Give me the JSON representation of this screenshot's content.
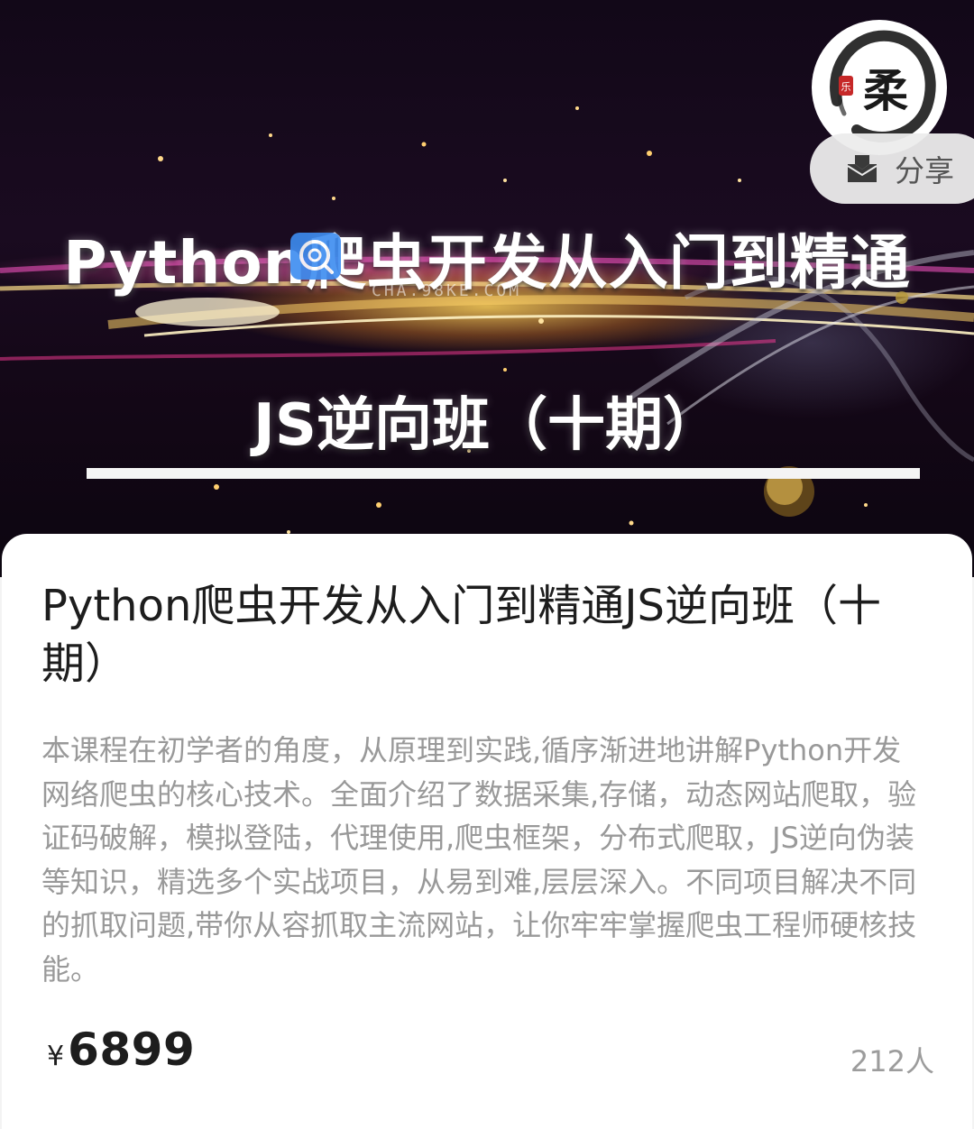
{
  "banner": {
    "title_line1": "Python爬虫开发从入门到精通",
    "title_line2": "JS逆向班（十期）",
    "watermark_text": "CHA.98KE.COM",
    "seal_char": "柔",
    "seal_stamp": "乐"
  },
  "share": {
    "label": "分享",
    "icon": "share-envelope-icon"
  },
  "course": {
    "title": "Python爬虫开发从入门到精通JS逆向班（十期）",
    "description": "本课程在初学者的角度，从原理到实践,循序渐进地讲解Python开发网络爬虫的核心技术。全面介绍了数据采集,存储，动态网站爬取，验证码破解，模拟登陆，代理使用,爬虫框架，分布式爬取，JS逆向伪装等知识，精选多个实战项目，从易到难,层层深入。不同项目解决不同的抓取问题,带你从容抓取主流网站，让你牢牢掌握爬虫工程师硬核技能。",
    "price_symbol": "¥",
    "price": "6899",
    "enrolled": "212人"
  }
}
